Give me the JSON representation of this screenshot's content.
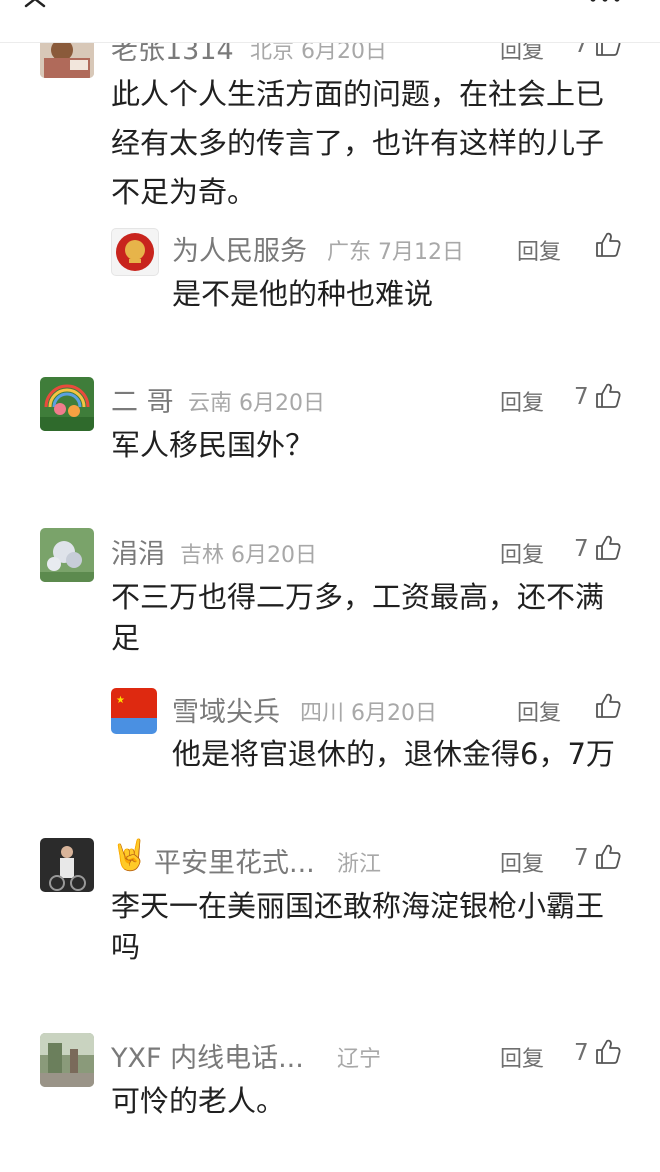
{
  "comments": [
    {
      "name": "老张1314",
      "region": "北京 6月20日",
      "reply": "回复",
      "likes": "7",
      "text": [
        "此人个人生活方面的问题，在社会上已",
        "经有太多的传言了，也许有这样的儿子",
        "不足为奇。"
      ]
    },
    {
      "name": "二 哥",
      "region": "云南 6月20日",
      "reply": "回复",
      "likes": "7",
      "text": [
        "军人移民国外？"
      ]
    },
    {
      "name": "涓涓",
      "region": "吉林 6月20日",
      "reply": "回复",
      "likes": "7",
      "text": [
        "不三万也得二万多，工资最高，还不满",
        "足"
      ]
    },
    {
      "name": "平安里花式...",
      "region": "浙江",
      "reply": "回复",
      "likes": "7",
      "text": [
        "李天一在美丽国还敢称海淀银枪小霸王",
        "吗"
      ]
    },
    {
      "name": "YXF  内线电话...",
      "region": "辽宁",
      "reply": "回复",
      "likes": "7",
      "text": [
        "可怜的老人。"
      ]
    }
  ],
  "replies": [
    {
      "name": "为人民服务",
      "region": "广东 7月12日",
      "reply": "回复",
      "text": "是不是他的种也难说"
    },
    {
      "name": "雪域尖兵",
      "region": "四川 6月20日",
      "reply": "回复",
      "text": "他是将官退休的，退休金得6，7万"
    }
  ],
  "emoji": "🤘",
  "colors": {
    "text": "#202020",
    "name": "#7a7a7a",
    "meta": "#a8a8a8",
    "flag_red": "#de2910",
    "flag_blue": "#4a90e2"
  }
}
